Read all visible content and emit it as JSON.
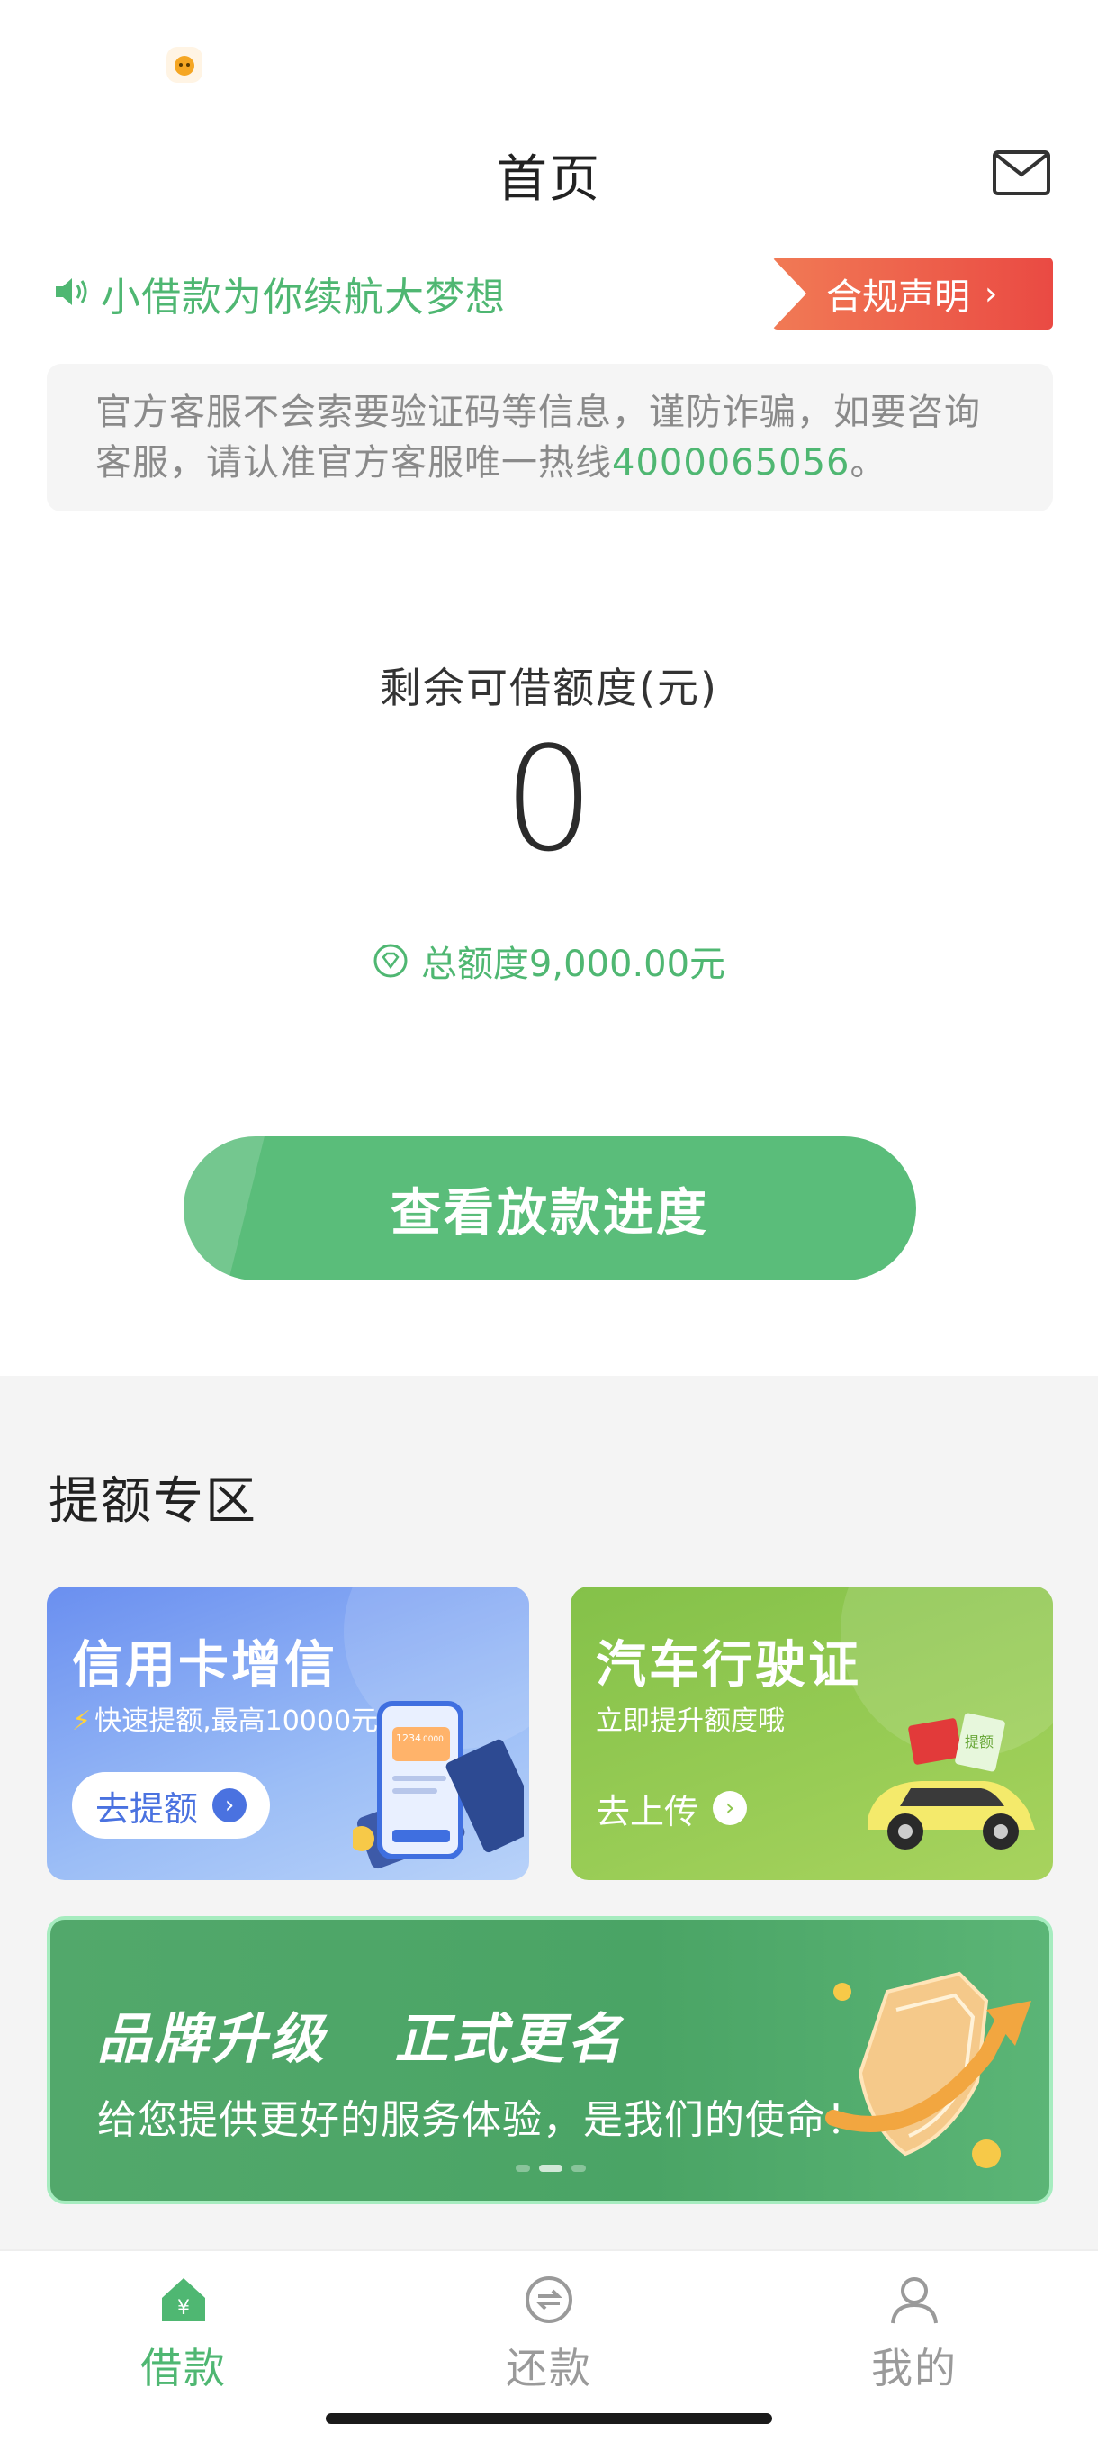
{
  "header": {
    "title": "首页"
  },
  "slogan": "小借款为你续航大梦想",
  "compliance": {
    "label": "合规声明",
    "chevron": "›"
  },
  "notice": {
    "text": "官方客服不会索要验证码等信息，谨防诈骗，如要咨询客服，请认准官方客服唯一热线",
    "hotline": "4000065056",
    "end": "。"
  },
  "credit": {
    "label": "剩余可借额度(元)",
    "value": "0",
    "total": "总额度9,000.00元"
  },
  "progress_button": "查看放款进度",
  "section_title": "提额专区",
  "cards": {
    "credit_card": {
      "title": "信用卡增信",
      "subtitle": "快速提额,最高10000元",
      "button": "去提额",
      "card_digits": "1234",
      "card_digits2": "0000"
    },
    "car": {
      "title": "汽车行驶证",
      "subtitle": "立即提升额度哦",
      "button": "去上传",
      "tag": "提额"
    }
  },
  "banner": {
    "title": "品牌升级   正式更名",
    "subtitle": "给您提供更好的服务体验，是我们的使命！",
    "active_slide": 2,
    "slide_count": 3
  },
  "tabs": [
    {
      "label": "借款",
      "icon": "home-icon",
      "active": true
    },
    {
      "label": "还款",
      "icon": "repay-icon",
      "active": false
    },
    {
      "label": "我的",
      "icon": "user-icon",
      "active": false
    }
  ],
  "colors": {
    "brand_green": "#4fb772",
    "button_green": "#5abd7a",
    "alert_red": "#ea4a43"
  }
}
